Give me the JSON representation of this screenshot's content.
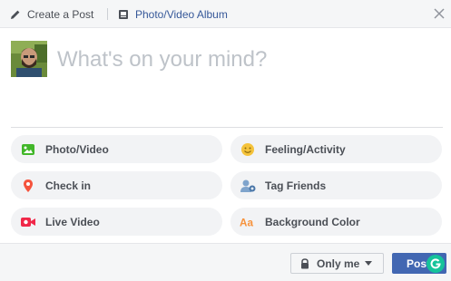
{
  "header": {
    "create_post_label": "Create a Post",
    "photo_album_label": "Photo/Video Album",
    "icons": {
      "create": "pencil-icon",
      "album": "photo-album-icon",
      "close": "close-icon"
    }
  },
  "composer": {
    "placeholder": "What's on your mind?"
  },
  "actions": [
    {
      "label": "Photo/Video",
      "icon": "photo-icon",
      "color": "#42b72a"
    },
    {
      "label": "Feeling/Activity",
      "icon": "smiley-icon",
      "color": "#f5c33b"
    },
    {
      "label": "Check in",
      "icon": "location-pin-icon",
      "color": "#f5533d"
    },
    {
      "label": "Tag Friends",
      "icon": "tag-friends-icon",
      "color": "#7fa4cc"
    },
    {
      "label": "Live Video",
      "icon": "live-video-icon",
      "color": "#f02849"
    },
    {
      "label": "Background Color",
      "icon": "text-aa-icon",
      "color": "#f7923b"
    }
  ],
  "footer": {
    "privacy_label": "Only me",
    "post_label": "Post",
    "post_color": "#4267b2"
  }
}
